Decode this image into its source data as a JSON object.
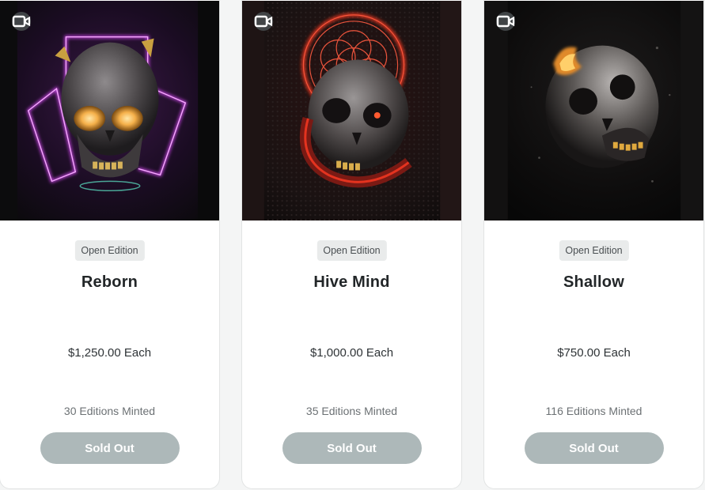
{
  "cards": [
    {
      "edition": "Open Edition",
      "title": "Reborn",
      "price": "$1,250.00 Each",
      "minted": "30 Editions Minted",
      "button": "Sold Out",
      "media_icon": "video-camera-icon",
      "artwork": "skull-neon-purple"
    },
    {
      "edition": "Open Edition",
      "title": "Hive Mind",
      "price": "$1,000.00 Each",
      "minted": "35 Editions Minted",
      "button": "Sold Out",
      "media_icon": "video-camera-icon",
      "artwork": "skull-red-halo"
    },
    {
      "edition": "Open Edition",
      "title": "Shallow",
      "price": "$750.00 Each",
      "minted": "116 Editions Minted",
      "button": "Sold Out",
      "media_icon": "video-camera-icon",
      "artwork": "skull-dark-gold"
    }
  ],
  "colors": {
    "button_bg": "#adb8b9",
    "pill_bg": "#e9ebeb",
    "title_text": "#222628"
  }
}
